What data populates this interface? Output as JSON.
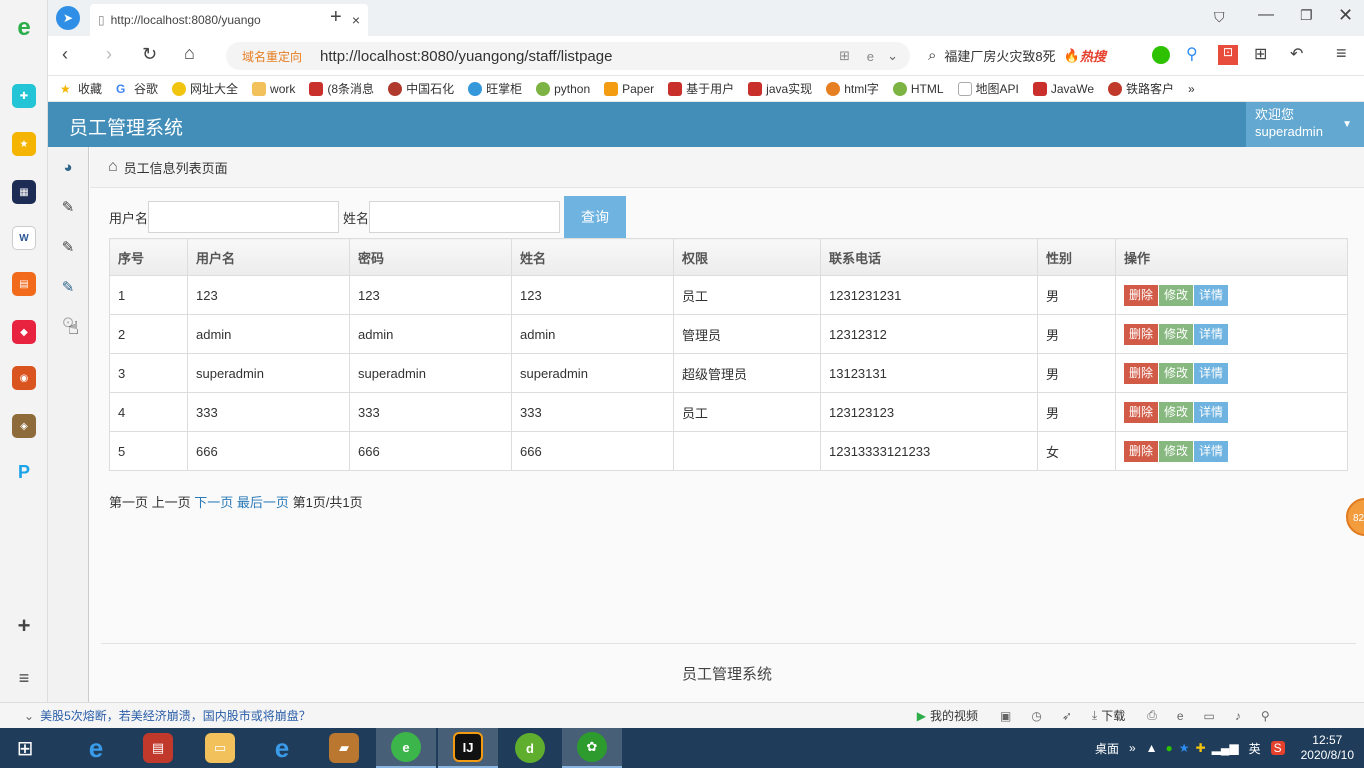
{
  "browser": {
    "tab_title": "http://localhost:8080/yuango",
    "redirect_label": "域名重定向",
    "url": "http://localhost:8080/yuangong/staff/listpage",
    "search_hint": "福建厂房火灾致8死",
    "hot_label": "热搜",
    "bookmarks": [
      "收藏",
      "谷歌",
      "网址大全",
      "work",
      "(8条消息",
      "中国石化",
      "旺掌柜",
      "python",
      "Paper",
      "基于用户",
      "java实现",
      "html字",
      "HTML",
      "地图API",
      "JavaWe",
      "铁路客户"
    ],
    "more_bookmarks": "»"
  },
  "app": {
    "title": "员工管理系统",
    "welcome": "欢迎您",
    "username": "superadmin",
    "breadcrumb": "员工信息列表页面",
    "search": {
      "username_label": "用户名",
      "name_label": "姓名",
      "query_button": "查询"
    },
    "table": {
      "headers": [
        "序号",
        "用户名",
        "密码",
        "姓名",
        "权限",
        "联系电话",
        "性别",
        "操作"
      ],
      "rows": [
        [
          "1",
          "123",
          "123",
          "123",
          "员工",
          "1231231231",
          "男"
        ],
        [
          "2",
          "admin",
          "admin",
          "admin",
          "管理员",
          "12312312",
          "男"
        ],
        [
          "3",
          "superadmin",
          "superadmin",
          "superadmin",
          "超级管理员",
          "13123131",
          "男"
        ],
        [
          "4",
          "333",
          "333",
          "333",
          "员工",
          "123123123",
          "男"
        ],
        [
          "5",
          "666",
          "666",
          "666",
          "",
          "12313333121233",
          "女"
        ]
      ],
      "actions": {
        "delete": "删除",
        "edit": "修改",
        "detail": "详情"
      }
    },
    "pager": {
      "first": "第一页",
      "prev": "上一页",
      "next": "下一页",
      "last": "最后一页",
      "info": "第1页/共1页"
    },
    "footer": "员工管理系统",
    "float_badge": "82"
  },
  "statusbar": {
    "news": "美股5次熔断，若美经济崩溃，国内股市或将崩盘？",
    "my_video": "我的视频",
    "download": "下载"
  },
  "taskbar": {
    "desktop": "桌面",
    "ime": "英",
    "time": "12:57",
    "date": "2020/8/10"
  },
  "colors": {
    "header": "#438eb9",
    "delete": "#d15b47",
    "edit": "#87b87f",
    "detail": "#6fb3e0"
  }
}
